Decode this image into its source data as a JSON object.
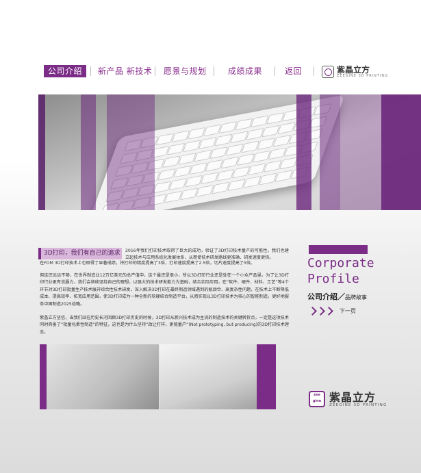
{
  "nav": {
    "items": [
      "公司介绍",
      "新产品 新技术",
      "愿景与规划",
      "成绩成果",
      "返回"
    ],
    "logo_name": "紫晶立方",
    "logo_sub": "ZEEGINE 3D PRINTING"
  },
  "article": {
    "title": "3D打印，我们有自己的追求",
    "p1": "2016年我们打印技术取得了巨大的成功，验证了3D打印技术量产的可能性。我们也建立起技术与应用系统化发展体系，从而使技术研发路线更准确、研发速度更快。",
    "p1b": "在FDM 3D打印技术上也取得了显著成绩，将打印的精度提高了3倍，打印速度提高了2.5倍，切片速度提高了5倍。",
    "p2": "但这还远远不够，在世界制造业12万亿美元的总产值中，这个量还是很小，所以3D打印行业还是处在一个小众产品里。为了让3D打印行业更有说服力，我们会继续坚持自己的理想，以强大的技术研发能力为基础，结合实际应用，在“软件、硬件、材料、工艺”等4个环节对3D打印批量生产技术展开综合性技术研发，深入解决3D打印在最终制造领域遇到的瓶颈合、高复杂性问题，在技术上不断降低成本、提高效率、拓宽应用范围，使3D打印成为一种全新的软硬结合制造平台，从而实现以3D打印技术为核心的智能制造，更好地服务中国制造2025战略。",
    "p3": "紫晶立方坚信，当我们站在历史长河回顾3D打印历史的时候，3D打印从新兴技术成为主流的制造技术的关键转折点，一定是这项技术同时具备了“批量化柔性制造”的特征，这也是为什么坚持“改让打样，更能量产”(Not prototyping, but producing)的3D打印技术理念。"
  },
  "side": {
    "title_line1": "Corporate",
    "title_line2": "Profile",
    "sub_main": "公司介绍／",
    "sub_small": "品牌故事",
    "next_label": "下一页"
  },
  "brand": {
    "mark": "zee gine",
    "name": "紫晶立方",
    "en": "ZEEGINE 3D PRINTING"
  },
  "colors": {
    "accent": "#7b2c87",
    "badge": "#d8b7da"
  }
}
